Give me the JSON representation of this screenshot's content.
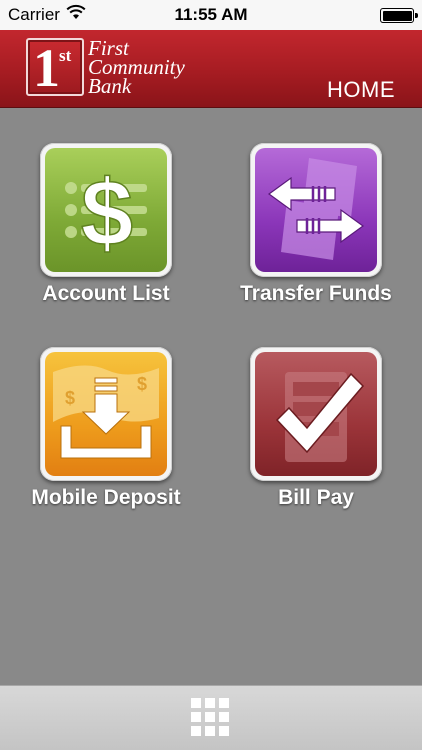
{
  "status_bar": {
    "carrier": "Carrier",
    "time": "11:55 AM"
  },
  "header": {
    "logo_numeral": "1",
    "logo_suffix": "st",
    "logo_lines": [
      "First",
      "Community",
      "Bank"
    ],
    "section_title": "HOME"
  },
  "tiles": [
    {
      "label": "Account List",
      "icon": "dollar-list-icon",
      "color": "#8bb43f"
    },
    {
      "label": "Transfer Funds",
      "icon": "transfer-arrows-icon",
      "color": "#8b36b9"
    },
    {
      "label": "Mobile Deposit",
      "icon": "deposit-download-icon",
      "color": "#ee9c1c"
    },
    {
      "label": "Bill Pay",
      "icon": "checkmark-icon",
      "color": "#9b3439"
    }
  ],
  "tabbar": {
    "menu_icon": "grid-menu-icon"
  },
  "colors": {
    "header_red": "#b3232a",
    "background_gray": "#898989",
    "tabbar_gray": "#cfcfcf"
  }
}
